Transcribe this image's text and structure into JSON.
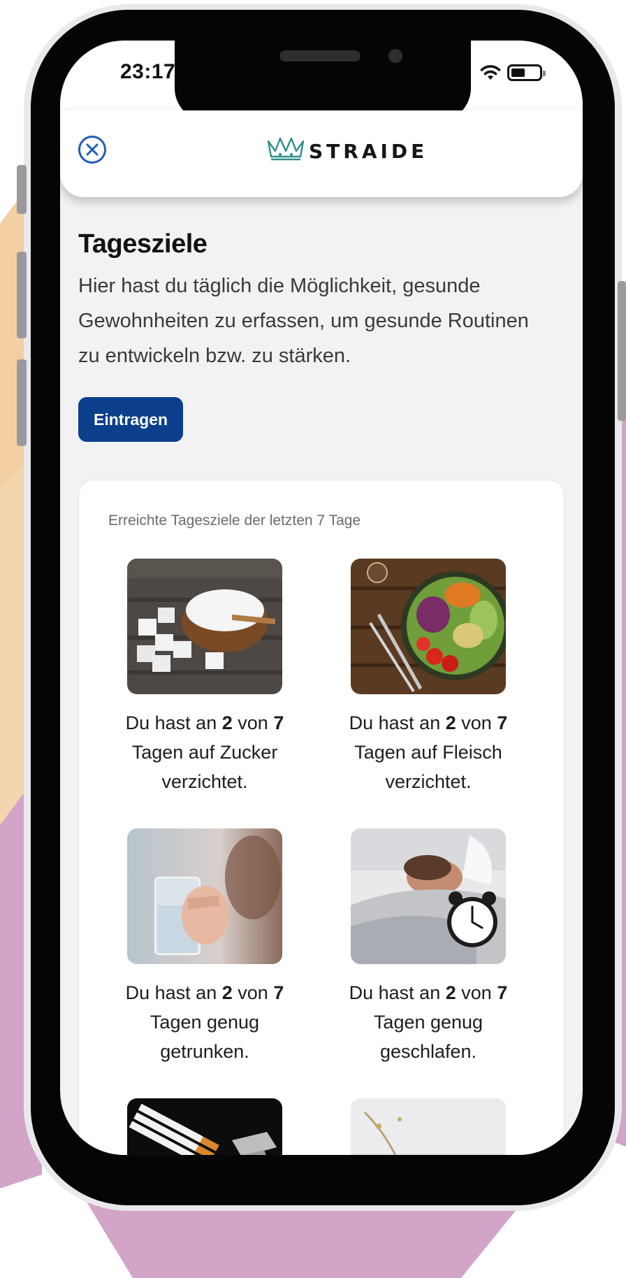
{
  "status_bar": {
    "time": "23:17"
  },
  "header": {
    "brand": "STRAIDE"
  },
  "page": {
    "title": "Tagesziele",
    "intro": "Hier hast du täglich die Möglichkeit, gesunde Gewohnheiten zu erfassen, um gesunde Routinen zu entwickeln bzw. zu stärken.",
    "enter_button": "Eintragen"
  },
  "card": {
    "title": "Erreichte Tagesziele der letzten 7 Tage",
    "goals": [
      {
        "prefix": "Du hast an",
        "achieved": "2",
        "of": "von",
        "total": "7",
        "suffix": "Tagen auf Zucker verzichtet."
      },
      {
        "prefix": "Du hast an",
        "achieved": "2",
        "of": "von",
        "total": "7",
        "suffix": "Tagen auf Fleisch verzichtet."
      },
      {
        "prefix": "Du hast an",
        "achieved": "2",
        "of": "von",
        "total": "7",
        "suffix": "Tagen genug getrunken."
      },
      {
        "prefix": "Du hast an",
        "achieved": "2",
        "of": "von",
        "total": "7",
        "suffix": "Tagen genug geschlafen."
      }
    ]
  },
  "icons": {
    "close": "close-circle-icon",
    "logo": "crown-icon",
    "wifi": "wifi-icon",
    "battery": "battery-icon"
  },
  "colors": {
    "primary": "#0b3f8c",
    "background_peach": "#f3cfa2",
    "background_purple": "#d1a4c8"
  }
}
